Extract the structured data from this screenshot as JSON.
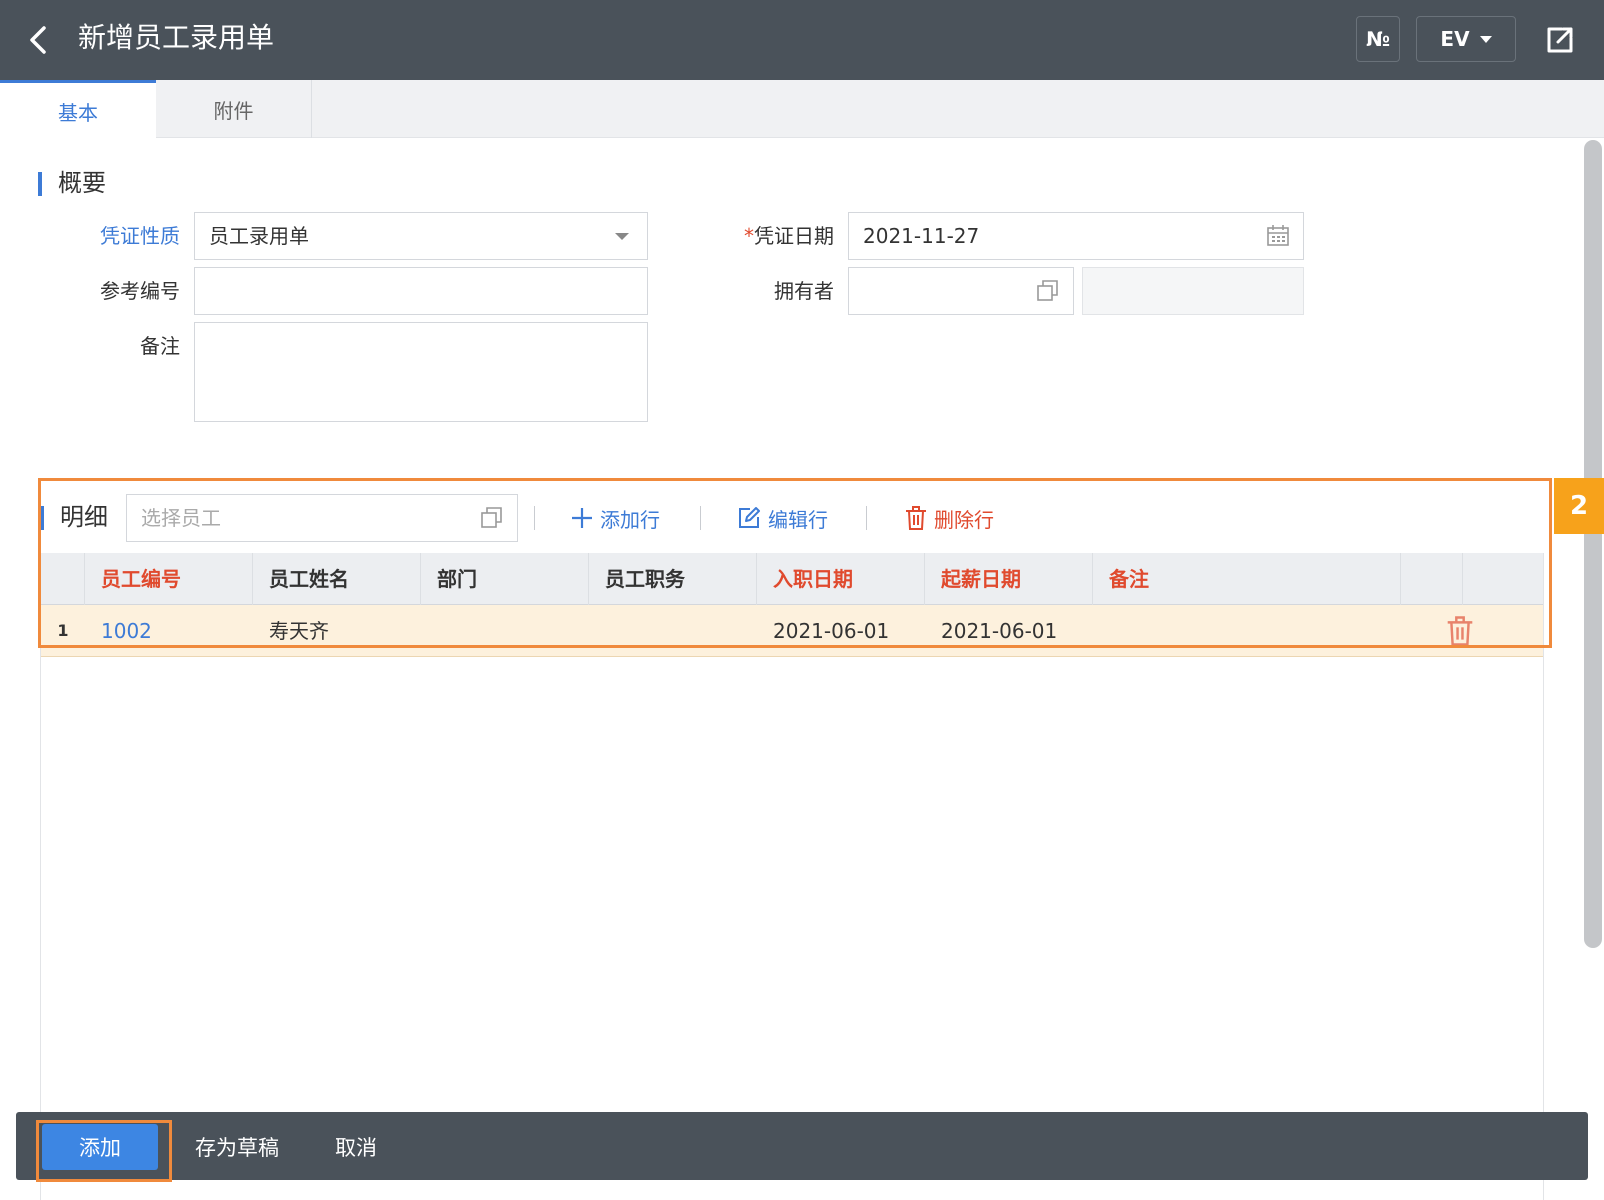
{
  "header": {
    "title": "新增员工录用单",
    "no_label": "№",
    "ev_label": "EV"
  },
  "tabs": [
    {
      "label": "基本",
      "active": true
    },
    {
      "label": "附件",
      "active": false
    }
  ],
  "summary": {
    "title": "概要",
    "voucher_type_label": "凭证性质",
    "voucher_type_value": "员工录用单",
    "ref_no_label": "参考编号",
    "ref_no_value": "",
    "remark_label": "备注",
    "remark_value": "",
    "date_required_mark": "*",
    "date_label": "凭证日期",
    "date_value": "2021-11-27",
    "owner_label": "拥有者",
    "owner_value": "",
    "owner_name_value": ""
  },
  "detail": {
    "title": "明细",
    "employee_placeholder": "选择员工",
    "add_row": "添加行",
    "edit_row": "编辑行",
    "delete_row": "删除行",
    "badge": "2",
    "columns": [
      "员工编号",
      "员工姓名",
      "部门",
      "员工职务",
      "入职日期",
      "起薪日期",
      "备注"
    ],
    "rows": [
      {
        "index": "1",
        "emp_no": "1002",
        "emp_name": "寿天齐",
        "dept": "",
        "position": "",
        "hire_date": "2021-06-01",
        "pay_start_date": "2021-06-01",
        "remark": ""
      }
    ]
  },
  "footer": {
    "add": "添加",
    "save_draft": "存为草稿",
    "cancel": "取消"
  },
  "colors": {
    "accent": "#3d7bd6",
    "header_bg": "#4a525a",
    "required": "#e04a2e",
    "highlight": "#f08a3c",
    "badge": "#f7a21b",
    "row_selected": "#fdf1dd"
  },
  "icons": {
    "back": "chevron-left-icon",
    "share": "external-share-icon",
    "dropdown": "caret-down-icon",
    "calendar": "calendar-icon",
    "lookup": "lookup-copy-icon",
    "add": "plus-icon",
    "edit": "edit-icon",
    "delete": "trash-icon"
  }
}
